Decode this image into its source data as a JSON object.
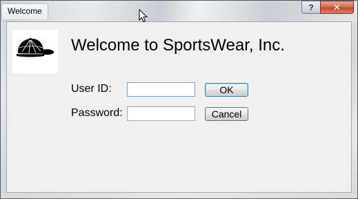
{
  "window": {
    "title": "Welcome",
    "help_label": "?",
    "close_label": "✕"
  },
  "logo": {
    "icon": "baseball-cap-icon"
  },
  "heading": "Welcome to SportsWear, Inc.",
  "form": {
    "user_id_label": "User ID:",
    "user_id_value": "",
    "password_label": "Password:",
    "password_value": "",
    "ok_label": "OK",
    "cancel_label": "Cancel"
  }
}
